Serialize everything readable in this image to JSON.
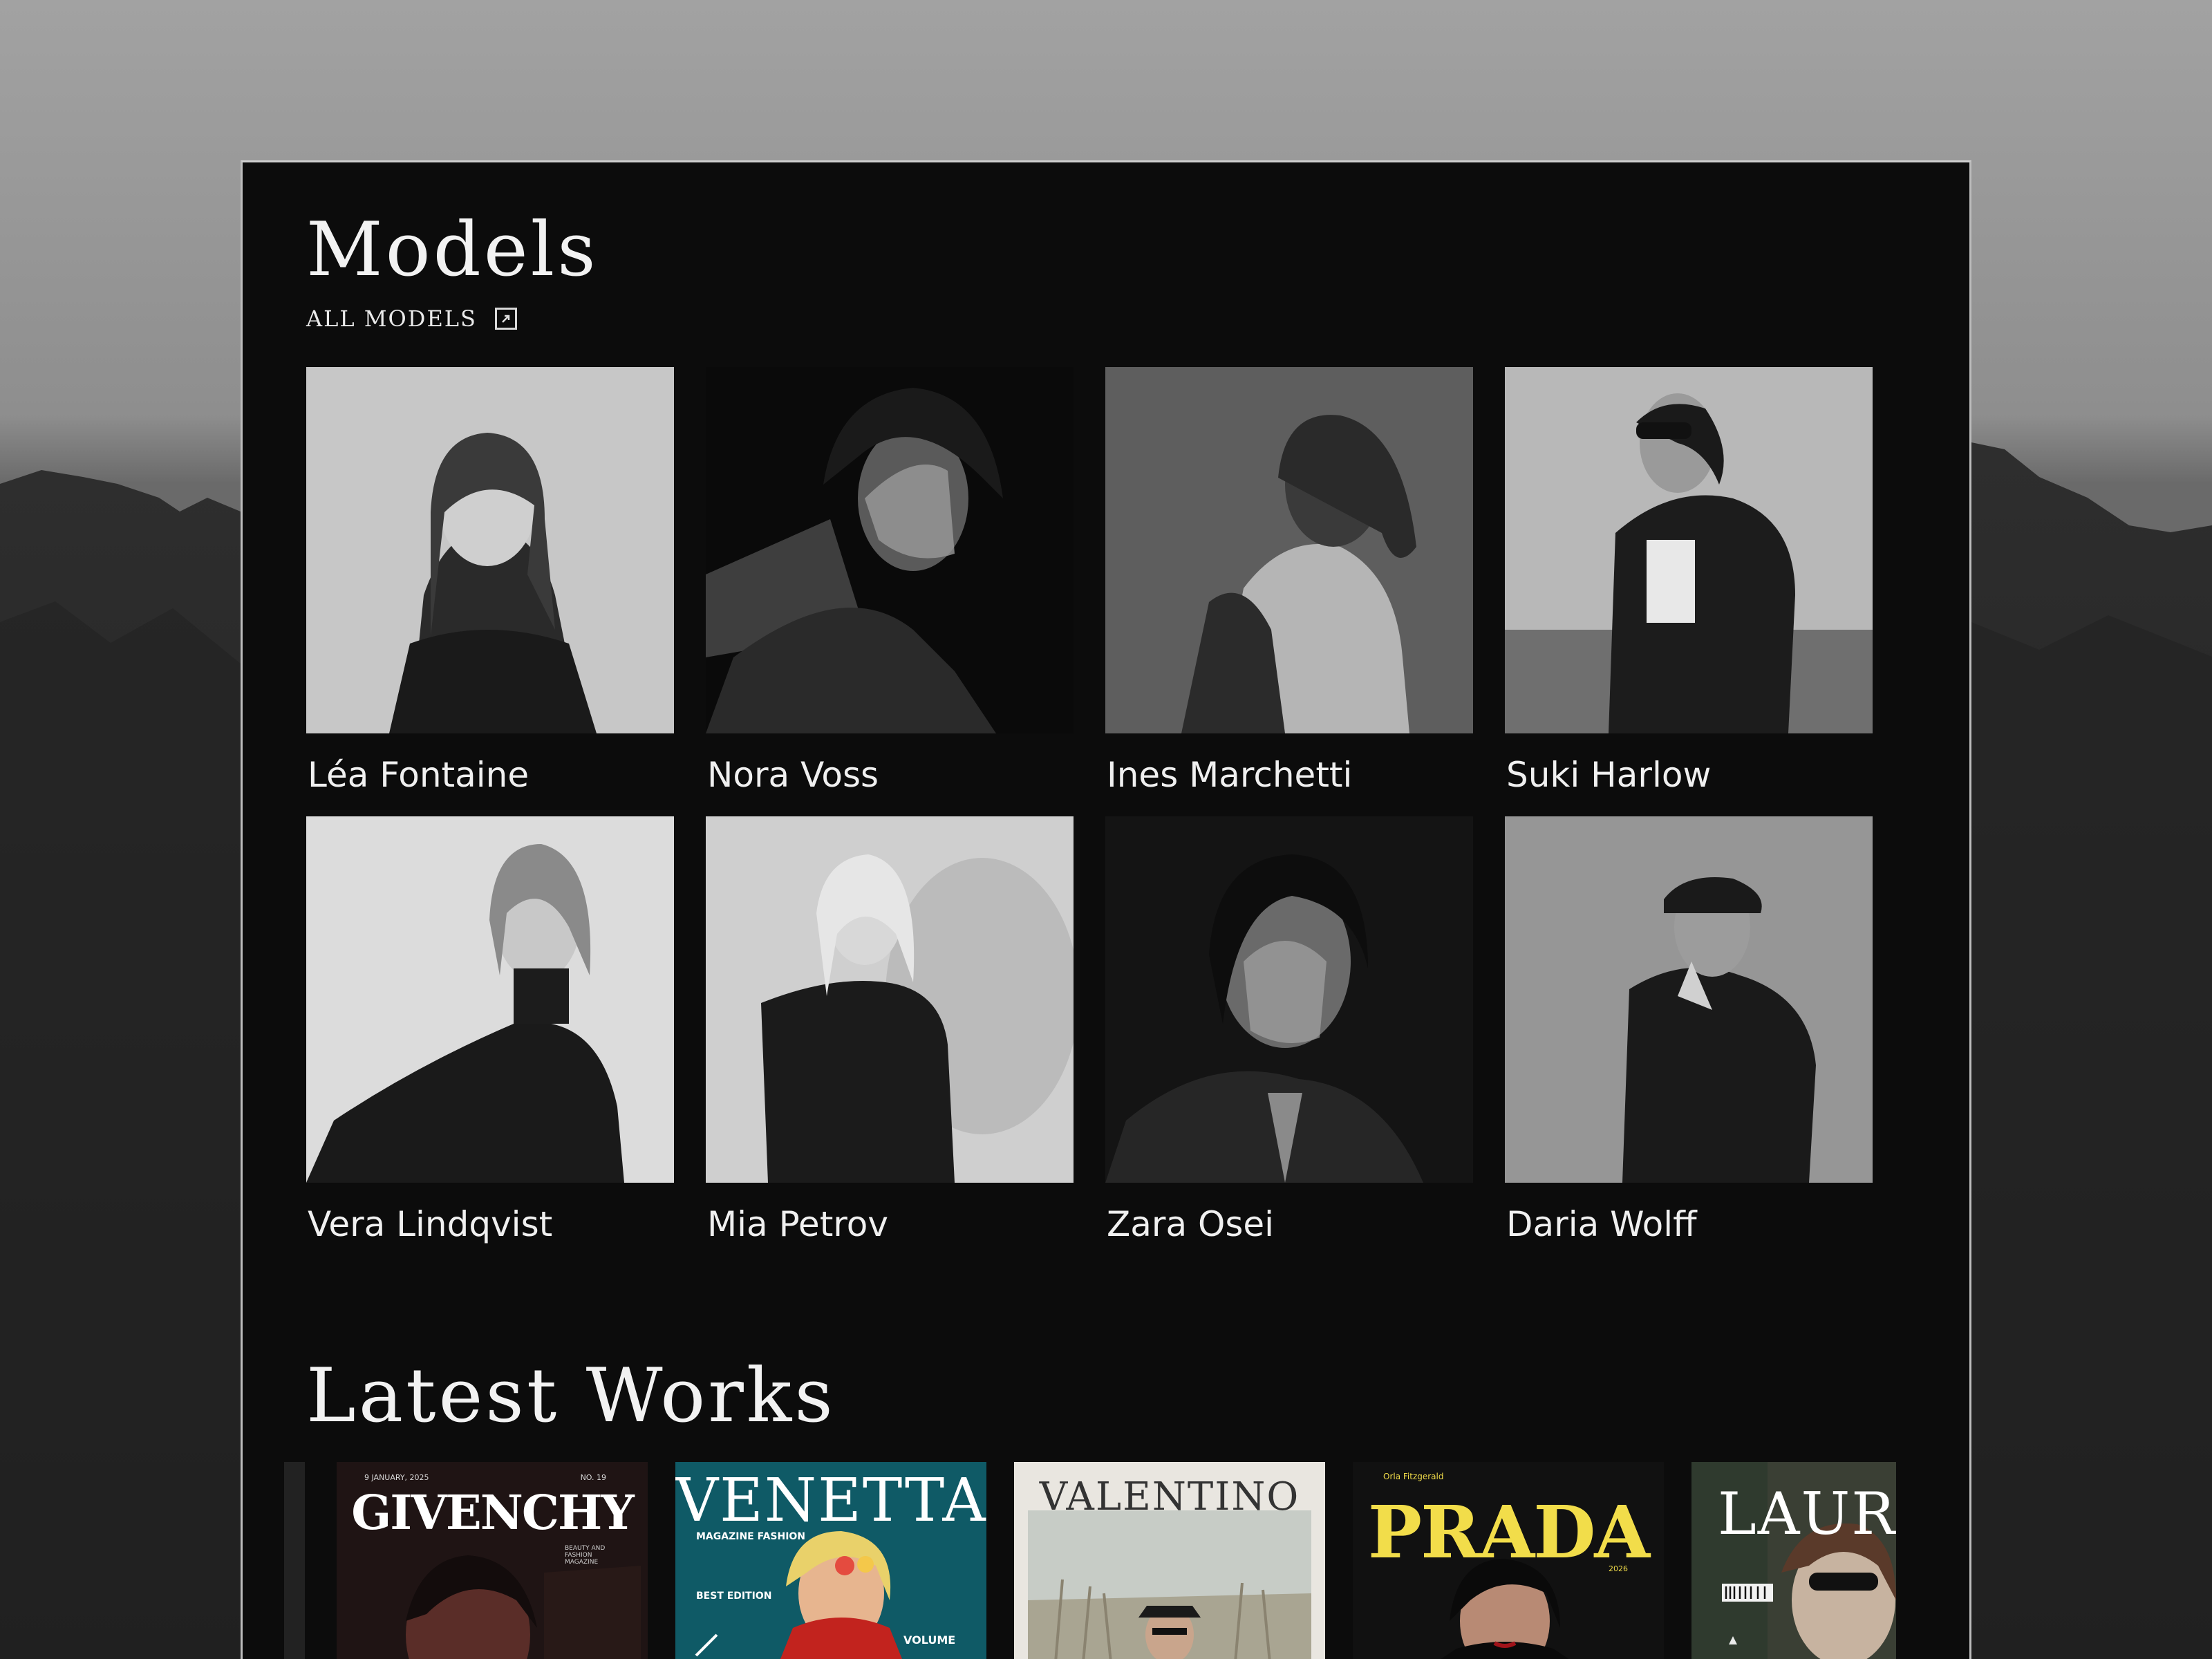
{
  "models_section": {
    "title": "Models",
    "all_models_label": "ALL MODELS",
    "models": [
      {
        "name": "Léa Fontaine"
      },
      {
        "name": "Nora Voss"
      },
      {
        "name": "Ines Marchetti"
      },
      {
        "name": "Suki Harlow"
      },
      {
        "name": "Vera Lindqvist"
      },
      {
        "name": "Mia Petrov"
      },
      {
        "name": "Zara Osei"
      },
      {
        "name": "Daria Wolff"
      }
    ]
  },
  "works_section": {
    "title": "Latest Works",
    "covers": [
      {
        "brand": "GIVENCHY",
        "date": "9 JANUARY, 2025",
        "issue": "NO. 19",
        "blurb": "BEAUTY AND FASHION MAGAZINE",
        "bg": "#1f1414"
      },
      {
        "brand": "VENETTA",
        "subtitle": "MAGAZINE FASHION",
        "edition": "BEST EDITION",
        "volume": "VOLUME",
        "bg": "#0f5a66"
      },
      {
        "brand": "VALENTINO",
        "bg": "#e9e6e0"
      },
      {
        "brand": "PRADA",
        "kicker": "Orla Fitzgerald",
        "year": "2026",
        "bg": "#111111",
        "accent": "#f2dd4a"
      },
      {
        "brand": "LAURE",
        "bg": "#3a3f34"
      }
    ]
  },
  "colors": {
    "panel_bg": "#0c0c0c",
    "text": "#f0f0f0",
    "page_bg": "#9a9a9a"
  }
}
